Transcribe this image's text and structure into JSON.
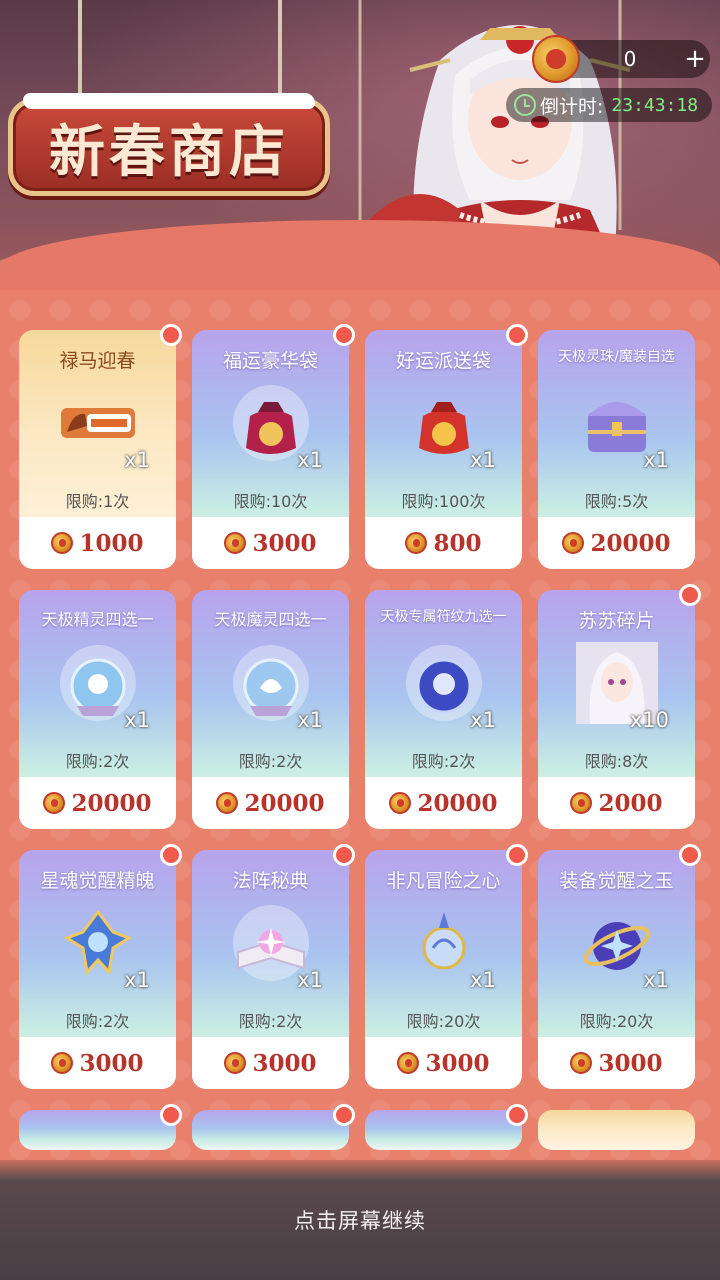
{
  "header": {
    "title": "新春商店",
    "currency_amount": "0",
    "currency_plus": "+",
    "countdown_label": "倒计时:",
    "countdown_time": "23:43:18"
  },
  "items": [
    {
      "name": "禄马迎春",
      "qty": "x1",
      "limit": "限购:1次",
      "price": "1000",
      "style": "gold",
      "icon": "horse-banner-icon",
      "badge": true
    },
    {
      "name": "福运豪华袋",
      "qty": "x1",
      "limit": "限购:10次",
      "price": "3000",
      "style": "purple",
      "icon": "lucky-bag-icon",
      "badge": true
    },
    {
      "name": "好运派送袋",
      "qty": "x1",
      "limit": "限购:100次",
      "price": "800",
      "style": "purple",
      "icon": "red-bag-icon",
      "badge": true
    },
    {
      "name": "天极灵珠/魔装自选",
      "qty": "x1",
      "limit": "限购:5次",
      "price": "20000",
      "style": "purple",
      "icon": "treasure-chest-icon",
      "badge": false
    },
    {
      "name": "天极精灵四选一",
      "qty": "x1",
      "limit": "限购:2次",
      "price": "20000",
      "style": "purple",
      "icon": "spirit-orb-icon",
      "badge": false
    },
    {
      "name": "天极魔灵四选一",
      "qty": "x1",
      "limit": "限购:2次",
      "price": "20000",
      "style": "purple",
      "icon": "demon-orb-icon",
      "badge": false
    },
    {
      "name": "天极专属符纹九选一",
      "qty": "x1",
      "limit": "限购:2次",
      "price": "20000",
      "style": "purple",
      "icon": "rune-orb-icon",
      "badge": false
    },
    {
      "name": "苏苏碎片",
      "qty": "x10",
      "limit": "限购:8次",
      "price": "2000",
      "style": "purple",
      "icon": "character-portrait-icon",
      "badge": true
    },
    {
      "name": "星魂觉醒精魄",
      "qty": "x1",
      "limit": "限购:2次",
      "price": "3000",
      "style": "purple",
      "icon": "star-crystal-icon",
      "badge": true
    },
    {
      "name": "法阵秘典",
      "qty": "x1",
      "limit": "限购:2次",
      "price": "3000",
      "style": "purple",
      "icon": "spell-book-icon",
      "badge": true
    },
    {
      "name": "非凡冒险之心",
      "qty": "x1",
      "limit": "限购:20次",
      "price": "3000",
      "style": "purple",
      "icon": "adventure-heart-icon",
      "badge": true
    },
    {
      "name": "装备觉醒之玉",
      "qty": "x1",
      "limit": "限购:20次",
      "price": "3000",
      "style": "purple",
      "icon": "jade-orb-icon",
      "badge": true
    }
  ],
  "footer": {
    "continue_text": "点击屏幕继续"
  },
  "colors": {
    "price_red": "#b8332a",
    "badge_red": "#ef5a4c",
    "countdown_green": "#7ef07e",
    "shop_bg": "#e9806b"
  }
}
